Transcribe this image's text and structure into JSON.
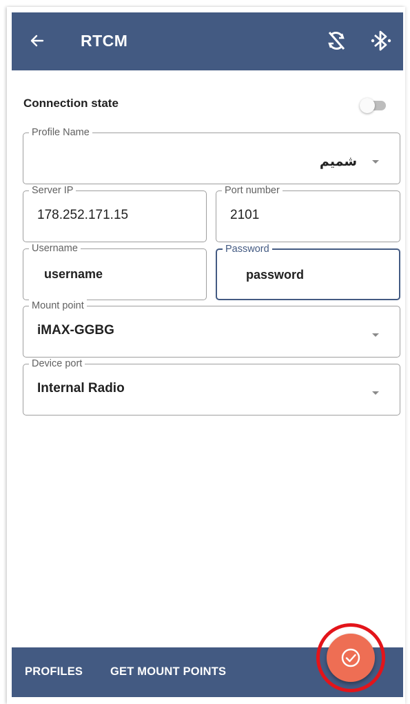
{
  "appbar": {
    "title": "RTCM",
    "icons": [
      "back-arrow-icon",
      "sync-disabled-icon",
      "bluetooth-searching-icon"
    ],
    "color": "#435a82"
  },
  "connection": {
    "label": "Connection state",
    "enabled": false
  },
  "form": {
    "profile_name": {
      "label": "Profile Name",
      "value": "شمیم"
    },
    "server_ip": {
      "label": "Server IP",
      "value": "178.252.171.15"
    },
    "port_number": {
      "label": "Port number",
      "value": "2101"
    },
    "username": {
      "label": "Username",
      "value": "username"
    },
    "password": {
      "label": "Password",
      "value": "password"
    },
    "mount_point": {
      "label": "Mount point",
      "value": "iMAX-GGBG"
    },
    "device_port": {
      "label": "Device port",
      "value": "Internal Radio"
    }
  },
  "bottombar": {
    "profiles_label": "PROFILES",
    "get_mount_points_label": "GET MOUNT POINTS"
  },
  "fab": {
    "icon": "check-circle-icon",
    "color": "#ee6e54",
    "highlight_color": "#e3141a"
  }
}
